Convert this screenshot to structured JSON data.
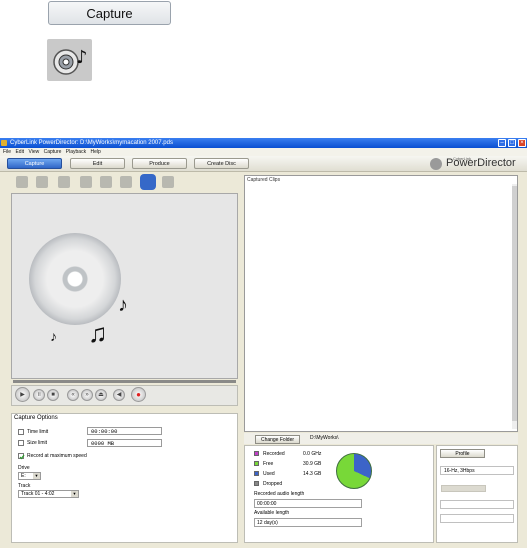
{
  "top": {
    "capture_button": "Capture"
  },
  "window": {
    "title": "CyberLink PowerDirector: D:\\MyWorks\\mymacation 2007.pds",
    "menu": [
      "File",
      "Edit",
      "View",
      "Capture",
      "Playback",
      "Help"
    ],
    "tabs": [
      "Capture",
      "Edit",
      "Produce",
      "Create Disc"
    ],
    "logo_small": "CyberLink",
    "logo": "PowerDirector"
  },
  "left": {
    "capture_options_title": "Capture Options",
    "time_limit_label": "Time limit",
    "time_limit_value": "00:00:00",
    "size_limit_label": "Size limit",
    "size_limit_value": "0000 MB",
    "record_max_label": "Record at maximum speed",
    "drive_label": "Drive",
    "drive_value": "E:",
    "track_label": "Track",
    "track_value": "Track 01 - 4:02"
  },
  "right": {
    "captured_clips_title": "Captured Clips",
    "change_folder_button": "Change Folder",
    "folder_path": "D:\\MyWorks\\",
    "legend": [
      {
        "label": "Recorded",
        "value": "0.0 GHz",
        "color": "#c040c8"
      },
      {
        "label": "Free",
        "value": "30.9 GB",
        "color": "#78d838"
      },
      {
        "label": "Used",
        "value": "14.3 GB",
        "color": "#3c64c8"
      },
      {
        "label": "Dropped",
        "value": "",
        "color": "#888888"
      }
    ],
    "recorded_audio_label": "Recorded audio length",
    "recorded_audio_value": "00:00:00",
    "available_length_label": "Available length",
    "available_length_value": "12 day(s)",
    "profile_button": "Profile",
    "profile_value": "16-Hz, 3Hbps",
    "disk_used_fraction": 0.32
  },
  "colors": {
    "free": "#78d838",
    "used": "#3c64c8",
    "tab_active": "#2f66c8"
  }
}
